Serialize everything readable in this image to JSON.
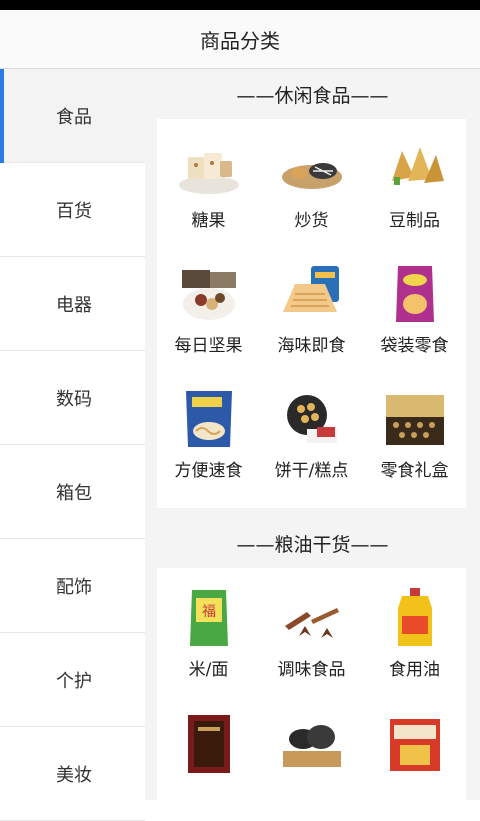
{
  "header": {
    "title": "商品分类"
  },
  "sidebar": {
    "items": [
      {
        "label": "食品",
        "active": true
      },
      {
        "label": "百货"
      },
      {
        "label": "电器"
      },
      {
        "label": "数码"
      },
      {
        "label": "箱包"
      },
      {
        "label": "配饰"
      },
      {
        "label": "个护"
      },
      {
        "label": "美妆"
      }
    ]
  },
  "sections": [
    {
      "title": "——休闲食品——",
      "items": [
        {
          "label": "糖果",
          "icon": "candy-icon"
        },
        {
          "label": "炒货",
          "icon": "roasted-nuts-icon"
        },
        {
          "label": "豆制品",
          "icon": "tofu-snack-icon"
        },
        {
          "label": "每日坚果",
          "icon": "daily-nuts-icon"
        },
        {
          "label": "海味即食",
          "icon": "seafood-snack-icon"
        },
        {
          "label": "袋装零食",
          "icon": "bagged-snack-icon"
        },
        {
          "label": "方便速食",
          "icon": "instant-noodle-icon"
        },
        {
          "label": "饼干/糕点",
          "icon": "biscuit-icon"
        },
        {
          "label": "零食礼盒",
          "icon": "gift-box-icon"
        }
      ]
    },
    {
      "title": "——粮油干货——",
      "items": [
        {
          "label": "米/面",
          "icon": "rice-bag-icon"
        },
        {
          "label": "调味食品",
          "icon": "spice-icon"
        },
        {
          "label": "食用油",
          "icon": "cooking-oil-icon"
        },
        {
          "label": "",
          "icon": "dried-goods-box-icon"
        },
        {
          "label": "",
          "icon": "mushroom-icon"
        },
        {
          "label": "",
          "icon": "gift-pack-icon"
        }
      ]
    }
  ]
}
